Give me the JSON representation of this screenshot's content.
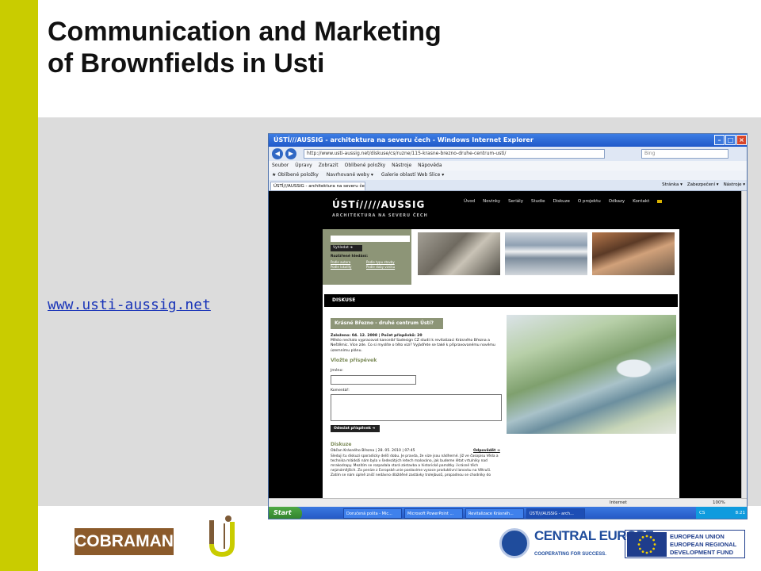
{
  "slide": {
    "title_line1": "Communication and Marketing",
    "title_line2": "of Brownfields in Usti",
    "link": "www.usti-aussig.net"
  },
  "colors": {
    "accent": "#c9cc00",
    "panel": "#dcdcdc",
    "link": "#1a35b8"
  },
  "browser": {
    "title": "ÚSTÍ///AUSSIG - architektura na severu čech - Windows Internet Explorer",
    "url": "http://www.usti-aussig.net/diskuse/cs/ruzne/115-krasne-brezno-druhe-centrum-usti/",
    "search_placeholder": "Bing",
    "menu": [
      "Soubor",
      "Úpravy",
      "Zobrazit",
      "Oblíbené položky",
      "Nástroje",
      "Nápověda"
    ],
    "favorites": {
      "label": "Oblíbené položky",
      "items": [
        "Navrhované weby ▾",
        "Galerie oblastí Web Slice ▾"
      ]
    },
    "tab_label": "ÚSTÍ///AUSSIG - architektura na severu čech",
    "tab_tools": [
      "Stránka ▾",
      "Zabezpečení ▾",
      "Nástroje ▾"
    ],
    "status_zone": "Internet",
    "zoom": "100%"
  },
  "site": {
    "logo": "ÚSTí/////AUSSIG",
    "logo_sub": "ARCHITEKTURA NA SEVERU ČECH",
    "nav": [
      "Úvod",
      "Novinky",
      "Seriály",
      "Studie",
      "Diskuze",
      "O projektu",
      "Odkazy",
      "Kontakt"
    ],
    "search_button": "Vyhledat ➜",
    "advanced_label": "Rozšířené hledání:",
    "advanced_links": [
      "Podle autora",
      "Podle typu stavby",
      "Podle lokality",
      "Podle doby vzniku"
    ],
    "section": "DISKUSE",
    "discussion_title": "Krásné Březno - druhé centrum Ústí?",
    "meta": "Založeno: 04. 12. 2008 | Počet příspěvků: 20",
    "intro": "Město nechalo vypracovat kancelář Sadesign CZ studii k revitalizaci Krásného Března a Neštěmic. Více zde. Co si myslíte o této vizi? Vyjádřete se také k připravovanému novému územnímu plánu.",
    "post_heading": "Vložte příspěvek",
    "name_label": "Jméno:",
    "comment_label": "Komentář:",
    "submit": "Odeslat příspěvek ➜",
    "discussion_heading": "Diskuze",
    "comment_author": "Občan Krásného Března | 28. 05. 2010 | 07:45",
    "reply": "Odpovědět ➜",
    "comment_text": "Sleduji tu diskuzi sporadicky delší dobu. Je pravda, že vize jsou nádherné. Již ve časopisu Věda a technika mládeži nám byla v šedesátých letech malováno, jak budeme létat vrtulníky nad mrakodrapy. Mezitím se rozpadala stará zástavba a historické památky i krásné těch nejznámějších. Za peníze z Evropské unie postavíme vysoce produktivní lanovku na Větruši. Zatím se nám úplně zničí nedávno dlážděné zastávky trolejbusů, propadnou se chodníky do"
  },
  "taskbar": {
    "start": "Start",
    "items": [
      "Doručená pošta - Mic...",
      "Microsoft PowerPoint ...",
      "Revitalizace Krásnéh...",
      "ÚSTÍ///AUSSIG - arch..."
    ],
    "lang": "CS",
    "clock": "8:21"
  },
  "logos": {
    "cobraman": "COBRAMAN",
    "central_europe": "CENTRAL EUROPE",
    "central_europe_tagline": "COOPERATING FOR SUCCESS.",
    "eu_lines": [
      "EUROPEAN UNION",
      "EUROPEAN REGIONAL",
      "DEVELOPMENT FUND"
    ]
  }
}
